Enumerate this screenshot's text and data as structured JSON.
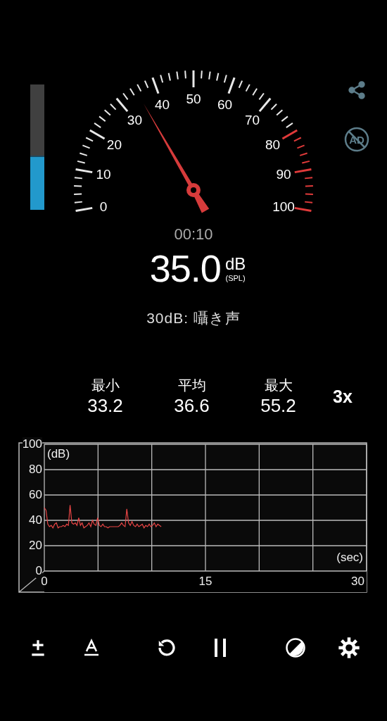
{
  "level_meter": {
    "level": 0.43
  },
  "gauge": {
    "labels": [
      "0",
      "10",
      "20",
      "30",
      "40",
      "50",
      "60",
      "70",
      "80",
      "90",
      "100"
    ]
  },
  "no_ads_badge": "AD",
  "elapsed": "00:10",
  "reading": {
    "value": "35.0",
    "unit": "dB",
    "weighting": "(SPL)"
  },
  "description": "30dB: 囁き声",
  "stats": [
    {
      "label": "最小",
      "value": "33.2"
    },
    {
      "label": "平均",
      "value": "36.6"
    },
    {
      "label": "最大",
      "value": "55.2"
    }
  ],
  "zoom_button": "3x",
  "chart": {
    "chart_data": {
      "type": "line",
      "xlabel": "(sec)",
      "ylabel": "(dB)",
      "xlim": [
        0,
        30
      ],
      "grid": true,
      "ylim": [
        0,
        100
      ],
      "xticks": [
        0,
        15,
        30
      ],
      "yticks": [
        0,
        20,
        40,
        60,
        80,
        100
      ],
      "x": [
        0,
        0.16,
        0.32,
        0.48,
        0.64,
        0.8,
        0.96,
        1.12,
        1.28,
        1.44,
        1.6,
        1.76,
        1.92,
        2.08,
        2.24,
        2.4,
        2.56,
        2.72,
        2.88,
        3.04,
        3.2,
        3.36,
        3.52,
        3.68,
        3.84,
        4,
        4.16,
        4.32,
        4.48,
        4.64,
        4.8,
        4.96,
        5.12,
        5.28,
        5.44,
        5.6,
        5.76,
        5.92,
        6.08,
        6.24,
        6.4,
        6.56,
        6.72,
        6.88,
        7.04,
        7.2,
        7.36,
        7.52,
        7.68,
        7.84,
        8,
        8.16,
        8.32,
        8.48,
        8.64,
        8.8,
        8.96,
        9.12,
        9.28,
        9.44,
        9.6,
        9.76,
        9.92,
        10.08,
        10.24,
        10.4,
        10.56,
        10.72,
        10.88
      ],
      "series": [
        {
          "color": "#e84545",
          "values": [
            50,
            48,
            37,
            35,
            36,
            34,
            37,
            38,
            34,
            35,
            35,
            36,
            35,
            37,
            36,
            52,
            38,
            37,
            38,
            36,
            42,
            36,
            38,
            34,
            35,
            36,
            38,
            35,
            40,
            37,
            36,
            42,
            36,
            35,
            37,
            35,
            35,
            34,
            35,
            35,
            35,
            35,
            35,
            35,
            36,
            38,
            36,
            35,
            49,
            38,
            36,
            39,
            36,
            35,
            37,
            35,
            36,
            37,
            34,
            36,
            35,
            37,
            35,
            36,
            38,
            35,
            37,
            36,
            35
          ]
        }
      ]
    }
  }
}
